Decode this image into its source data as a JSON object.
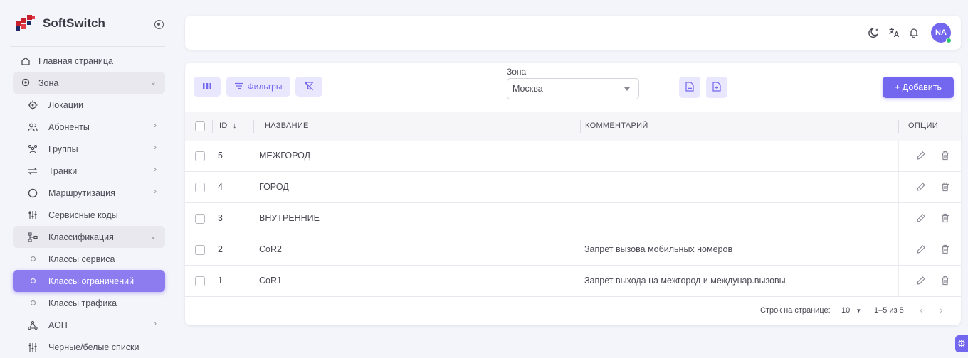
{
  "app": {
    "name": "SoftSwitch"
  },
  "sidebar": {
    "items": [
      {
        "label": "Главная страница",
        "icon": "home-icon"
      },
      {
        "label": "Зона",
        "icon": "location-pin-icon",
        "expanded": true
      },
      {
        "label": "Локации",
        "icon": "target-icon"
      },
      {
        "label": "Абоненты",
        "icon": "users-icon"
      },
      {
        "label": "Группы",
        "icon": "group-icon"
      },
      {
        "label": "Транки",
        "icon": "arrows-swap-icon"
      },
      {
        "label": "Маршрутизация",
        "icon": "circle-icon"
      },
      {
        "label": "Сервисные коды",
        "icon": "sliders-icon"
      },
      {
        "label": "Классификация",
        "icon": "hierarchy-icon",
        "expanded": true
      },
      {
        "label": "Классы сервиса",
        "icon": "bullet-icon"
      },
      {
        "label": "Классы ограничений",
        "icon": "bullet-icon",
        "selected": true
      },
      {
        "label": "Классы трафика",
        "icon": "bullet-icon"
      },
      {
        "label": "АОН",
        "icon": "network-icon"
      },
      {
        "label": "Черные/белые списки",
        "icon": "sliders-icon"
      }
    ]
  },
  "topbar": {
    "avatar_initials": "NA"
  },
  "toolbar": {
    "filters_label": "Фильтры",
    "zone_label": "Зона",
    "zone_value": "Москва",
    "add_label": "+ Добавить"
  },
  "table": {
    "columns": {
      "id": "ID",
      "name": "НАЗВАНИЕ",
      "comment": "КОММЕНТАРИЙ",
      "options": "ОПЦИИ"
    },
    "rows": [
      {
        "id": "5",
        "name": "МЕЖГОРОД",
        "comment": ""
      },
      {
        "id": "4",
        "name": "ГОРОД",
        "comment": ""
      },
      {
        "id": "3",
        "name": "ВНУТРЕННИЕ",
        "comment": ""
      },
      {
        "id": "2",
        "name": "CoR2",
        "comment": "Запрет вызова мобильных номеров"
      },
      {
        "id": "1",
        "name": "CoR1",
        "comment": "Запрет выхода на межгород и междунар.вызовы"
      }
    ]
  },
  "pagination": {
    "rows_per_page_label": "Строк на странице:",
    "rows_per_page_value": "10",
    "range_text": "1–5 из 5"
  },
  "colors": {
    "accent": "#7367f0",
    "online": "#28c76f"
  }
}
